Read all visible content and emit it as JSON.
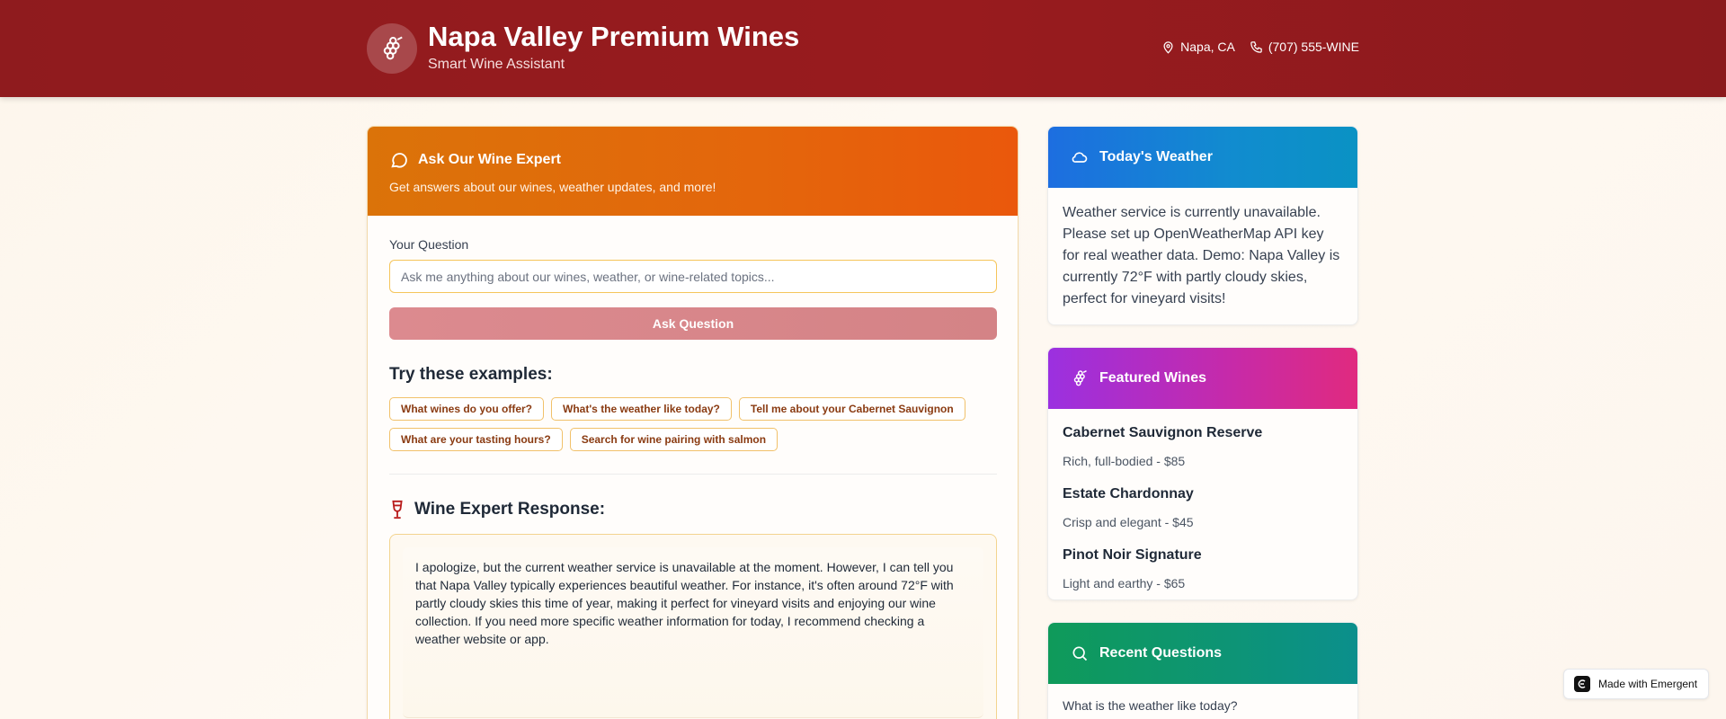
{
  "header": {
    "title": "Napa Valley Premium Wines",
    "subtitle": "Smart Wine Assistant",
    "location": "Napa, CA",
    "phone": "(707) 555-WINE"
  },
  "ask": {
    "title": "Ask Our Wine Expert",
    "subtitle": "Get answers about our wines, weather updates, and more!",
    "question_label": "Your Question",
    "placeholder": "Ask me anything about our wines, weather, or wine-related topics...",
    "value": "",
    "button_label": "Ask Question",
    "examples_title": "Try these examples:",
    "examples": [
      "What wines do you offer?",
      "What's the weather like today?",
      "Tell me about your Cabernet Sauvignon",
      "What are your tasting hours?",
      "Search for wine pairing with salmon"
    ],
    "response_title": "Wine Expert Response:",
    "response_text": "I apologize, but the current weather service is unavailable at the moment. However, I can tell you that Napa Valley typically experiences beautiful weather. For instance, it's often around 72°F with partly cloudy skies this time of year, making it perfect for vineyard visits and enjoying our wine collection. If you need more specific weather information for today, I recommend checking a weather website or app."
  },
  "weather": {
    "title": "Today's Weather",
    "text": "Weather service is currently unavailable. Please set up OpenWeatherMap API key for real weather data. Demo: Napa Valley is currently 72°F with partly cloudy skies, perfect for vineyard visits!"
  },
  "featured": {
    "title": "Featured Wines",
    "wines": [
      {
        "name": "Cabernet Sauvignon Reserve",
        "desc": "Rich, full-bodied - $85"
      },
      {
        "name": "Estate Chardonnay",
        "desc": "Crisp and elegant - $45"
      },
      {
        "name": "Pinot Noir Signature",
        "desc": "Light and earthy - $65"
      }
    ]
  },
  "recent": {
    "title": "Recent Questions",
    "items": [
      "What is the weather like today?"
    ]
  },
  "badge": {
    "label": "Made with Emergent"
  },
  "icons": {
    "logo": "grapes-icon",
    "location": "map-pin-icon",
    "phone": "phone-icon",
    "ask": "chat-bubble-icon",
    "response": "wine-glass-icon",
    "weather": "cloud-icon",
    "featured": "grapes-icon",
    "recent": "search-icon"
  },
  "colors": {
    "header": "#981b1e",
    "ask_header": "#e4660c",
    "weather_header": "#118ccf",
    "featured_header": "#c72aa8",
    "recent_header": "#0d9476"
  }
}
